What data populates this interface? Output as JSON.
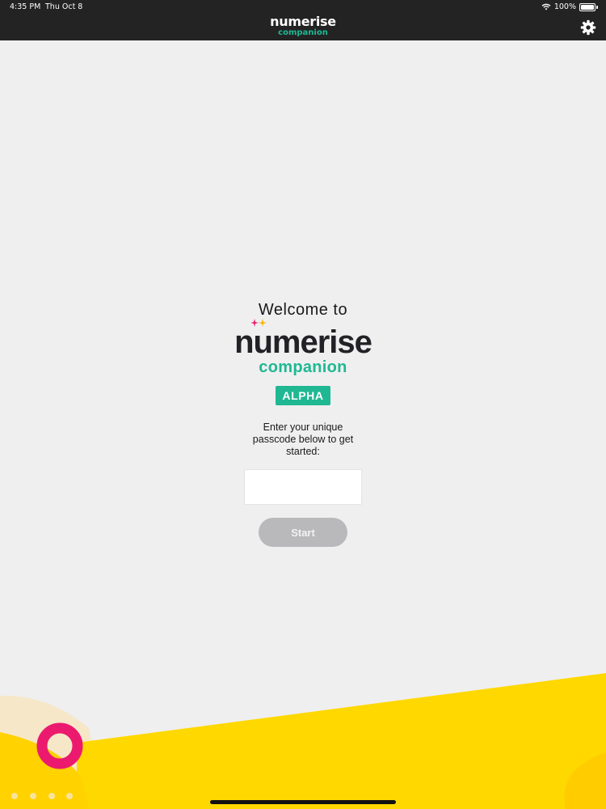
{
  "status_bar": {
    "time": "4:35 PM",
    "date": "Thu Oct 8",
    "battery": "100%"
  },
  "nav": {
    "logo_word": "numerise",
    "logo_sub": "companion",
    "settings_icon": "gear-icon"
  },
  "main": {
    "welcome": "Welcome to",
    "logo_word": "numerise",
    "logo_sub": "companion",
    "badge": "ALPHA",
    "prompt": "Enter your unique passcode below to get started:",
    "passcode": {
      "value": "",
      "placeholder": ""
    },
    "start_label": "Start"
  },
  "colors": {
    "brand_green": "#1fb893",
    "dark_bar": "#232324",
    "accent_pink": "#ec1a6e",
    "accent_yellow": "#ffd800",
    "disabled_button": "#b9b9bb"
  }
}
